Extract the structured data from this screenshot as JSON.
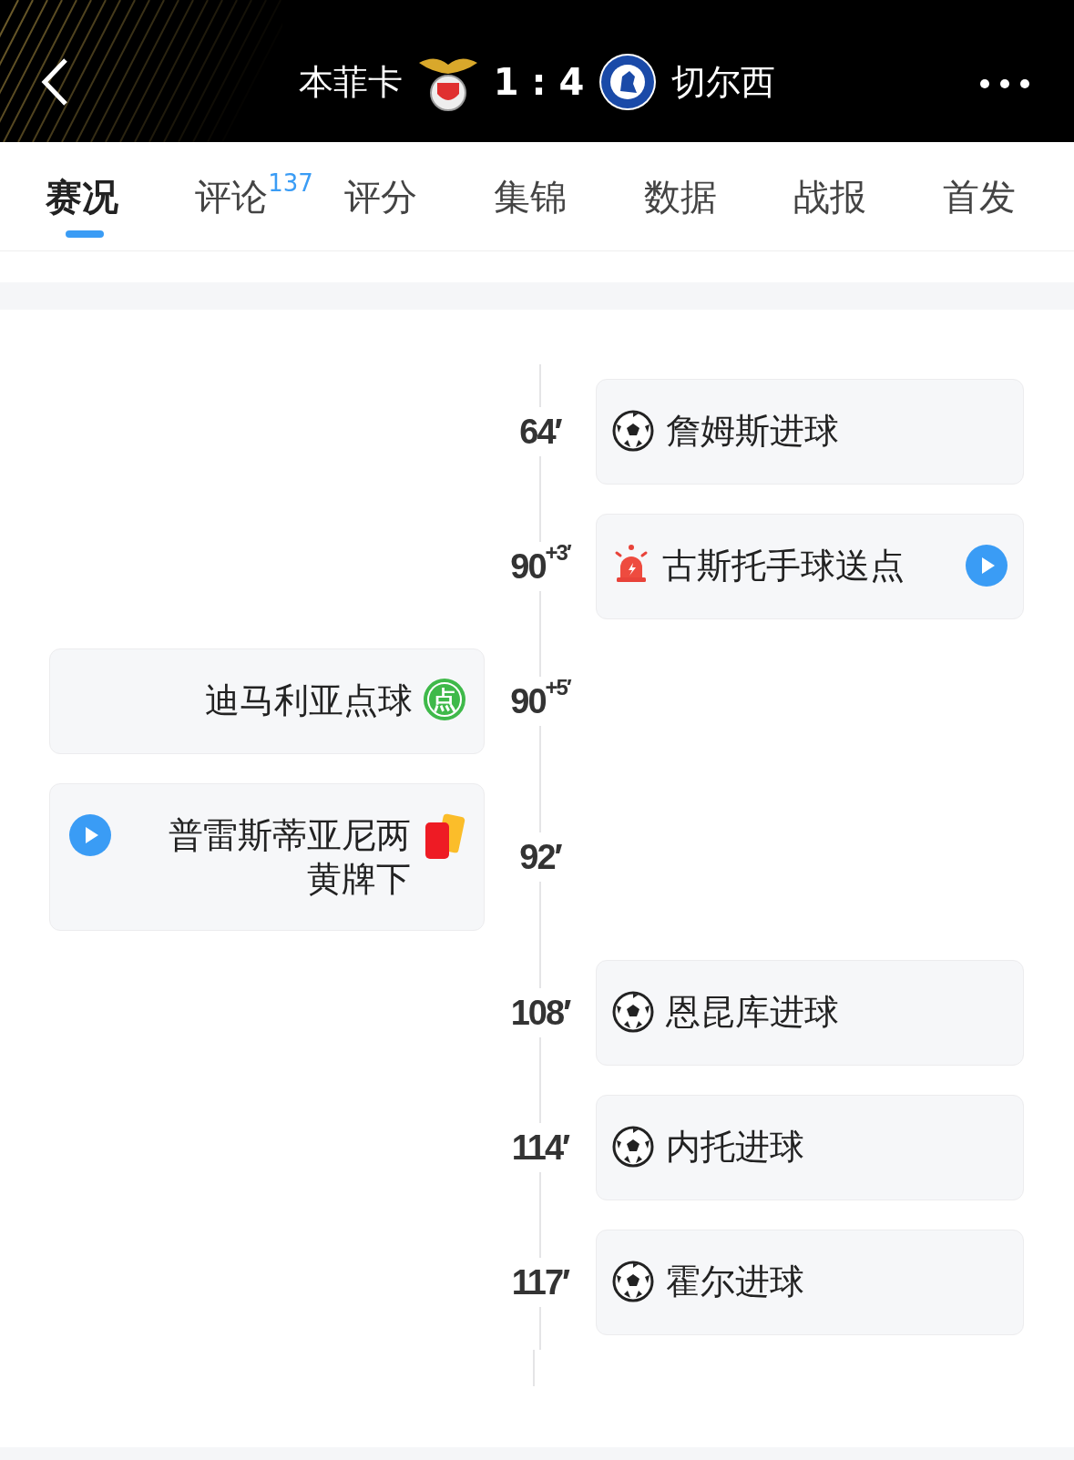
{
  "header": {
    "home": "本菲卡",
    "score": "1 : 4",
    "away": "切尔西"
  },
  "tabs": [
    {
      "label": "赛况",
      "selected": true
    },
    {
      "label": "评论",
      "badge": "137",
      "selected": false
    },
    {
      "label": "评分",
      "selected": false
    },
    {
      "label": "集锦",
      "selected": false
    },
    {
      "label": "数据",
      "selected": false
    },
    {
      "label": "战报",
      "selected": false
    },
    {
      "label": "首发",
      "selected": false
    }
  ],
  "events": [
    {
      "home": false,
      "kind": "goal",
      "minute": "64′",
      "text": "詹姆斯进球",
      "video": false
    },
    {
      "home": false,
      "kind": "penalty_given",
      "minute": "90",
      "extra": "+3′",
      "text": "古斯托手球送点",
      "video": true
    },
    {
      "home": true,
      "kind": "penalty_scored",
      "minute": "90",
      "extra": "+5′",
      "text": "迪马利亚点球",
      "badge": "点",
      "video": false
    },
    {
      "home": true,
      "kind": "red_card",
      "minute": "92′",
      "text": "普雷斯蒂亚尼两黄牌下",
      "video": true
    },
    {
      "home": false,
      "kind": "goal",
      "minute": "108′",
      "text": "恩昆库进球",
      "video": false
    },
    {
      "home": false,
      "kind": "goal",
      "minute": "114′",
      "text": "内托进球",
      "video": false
    },
    {
      "home": false,
      "kind": "goal",
      "minute": "117′",
      "text": "霍尔进球",
      "video": false
    }
  ]
}
